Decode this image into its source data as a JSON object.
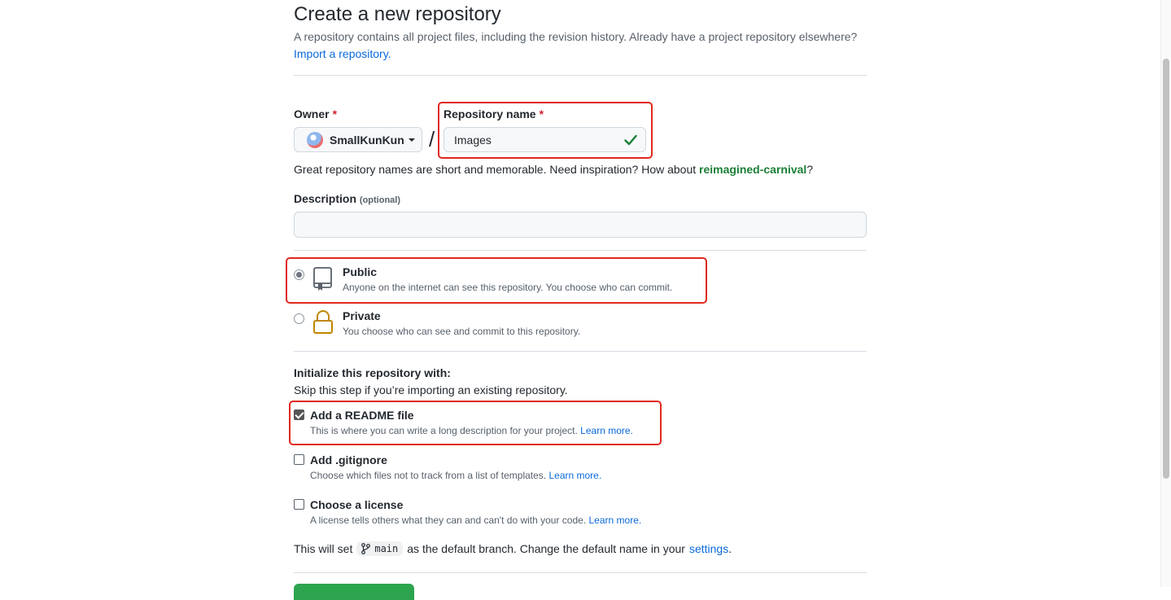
{
  "header": {
    "title": "Create a new repository",
    "subtitle": "A repository contains all project files, including the revision history. Already have a project repository elsewhere?",
    "import_link": "Import a repository."
  },
  "owner": {
    "label": "Owner",
    "required": "*",
    "value": "SmallKunKun"
  },
  "separator": "/",
  "repo_name": {
    "label": "Repository name",
    "required": "*",
    "value": "Images",
    "status_icon": "check-icon"
  },
  "name_hint": {
    "text": "Great repository names are short and memorable. Need inspiration? How about",
    "suggestion": "reimagined-carnival",
    "suffix": "?"
  },
  "description": {
    "label": "Description",
    "optional": "(optional)",
    "value": ""
  },
  "visibility": {
    "options": [
      {
        "title": "Public",
        "desc": "Anyone on the internet can see this repository. You choose who can commit.",
        "selected": true,
        "icon": "repo-icon"
      },
      {
        "title": "Private",
        "desc": "You choose who can see and commit to this repository.",
        "selected": false,
        "icon": "lock-icon"
      }
    ]
  },
  "init": {
    "heading": "Initialize this repository with:",
    "subheading": "Skip this step if you’re importing an existing repository.",
    "options": [
      {
        "title": "Add a README file",
        "desc": "This is where you can write a long description for your project.",
        "link": "Learn more.",
        "checked": true
      },
      {
        "title": "Add .gitignore",
        "desc": "Choose which files not to track from a list of templates.",
        "link": "Learn more.",
        "checked": false
      },
      {
        "title": "Choose a license",
        "desc": "A license tells others what they can and can't do with your code.",
        "link": "Learn more.",
        "checked": false
      }
    ]
  },
  "branch_note": {
    "prefix": "This will set",
    "branch": "main",
    "middle": "as the default branch. Change the default name in your",
    "link": "settings",
    "suffix": "."
  },
  "colors": {
    "link": "#0969da",
    "accent_green": "#1a7f37",
    "highlight": "#e0291d",
    "create_button": "#2da44e"
  }
}
